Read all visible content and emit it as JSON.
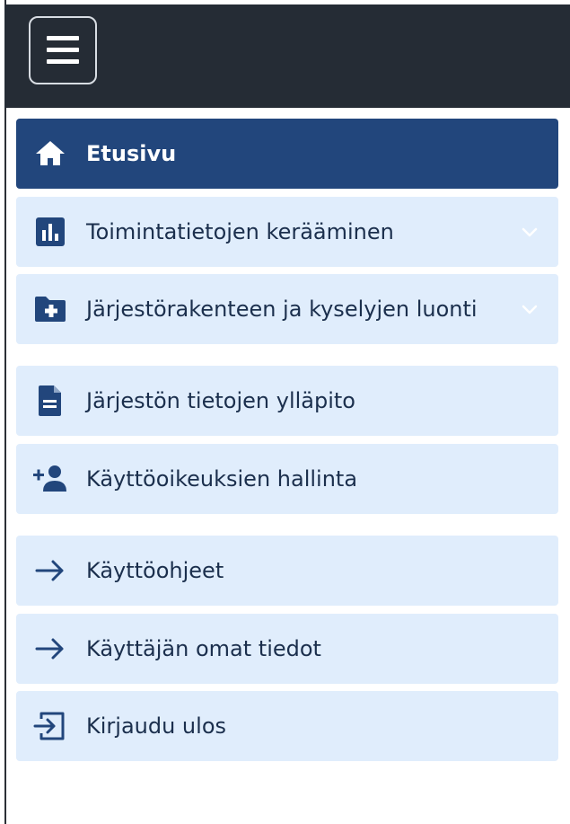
{
  "header": {
    "menu_icon": "hamburger-menu-icon"
  },
  "nav": {
    "items": [
      {
        "label": "Etusivu",
        "icon": "home-icon",
        "active": true
      },
      {
        "label": "Toimintatietojen kerääminen",
        "icon": "bar-chart-icon",
        "expandable": true
      },
      {
        "label": "Järjestörakenteen ja kyselyjen luonti",
        "icon": "folder-plus-icon",
        "expandable": true
      },
      {
        "label": "Järjestön tietojen ylläpito",
        "icon": "document-icon"
      },
      {
        "label": "Käyttöoikeuksien hallinta",
        "icon": "add-user-icon"
      },
      {
        "label": "Käyttöohjeet",
        "icon": "arrow-right-icon"
      },
      {
        "label": "Käyttäjän omat tiedot",
        "icon": "arrow-right-icon"
      },
      {
        "label": "Kirjaudu ulos",
        "icon": "logout-icon"
      }
    ]
  },
  "colors": {
    "topbar": "#252c35",
    "active_item": "#22467c",
    "item_background": "#e0edfc",
    "icon_color": "#22467c",
    "label_color": "#1b2f4d"
  }
}
